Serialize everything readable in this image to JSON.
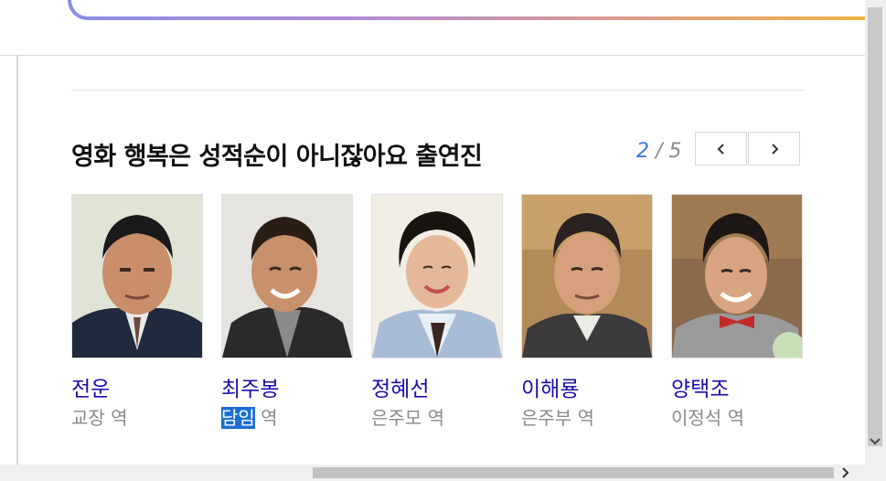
{
  "section": {
    "title": "영화 행복은 성적순이 아니잖아요 출연진",
    "pager": {
      "current": "2",
      "separator": " / ",
      "total": "5"
    }
  },
  "cast": [
    {
      "name": "전운",
      "role": "교장",
      "role_suffix": "역"
    },
    {
      "name": "최주봉",
      "role": "담임",
      "role_suffix": "역"
    },
    {
      "name": "정혜선",
      "role": "은주모",
      "role_suffix": "역"
    },
    {
      "name": "이해룡",
      "role": "은주부",
      "role_suffix": "역"
    },
    {
      "name": "양택조",
      "role": "이정석",
      "role_suffix": "역"
    }
  ],
  "icons": {
    "prev": "chevron-left-icon",
    "next": "chevron-right-icon",
    "scroll_down": "chevron-down-icon",
    "scroll_right": "chevron-right-icon"
  },
  "colors": {
    "name_link": "#1a0dab",
    "pager_current": "#3a78d6",
    "selection": "#1c6fd1"
  }
}
